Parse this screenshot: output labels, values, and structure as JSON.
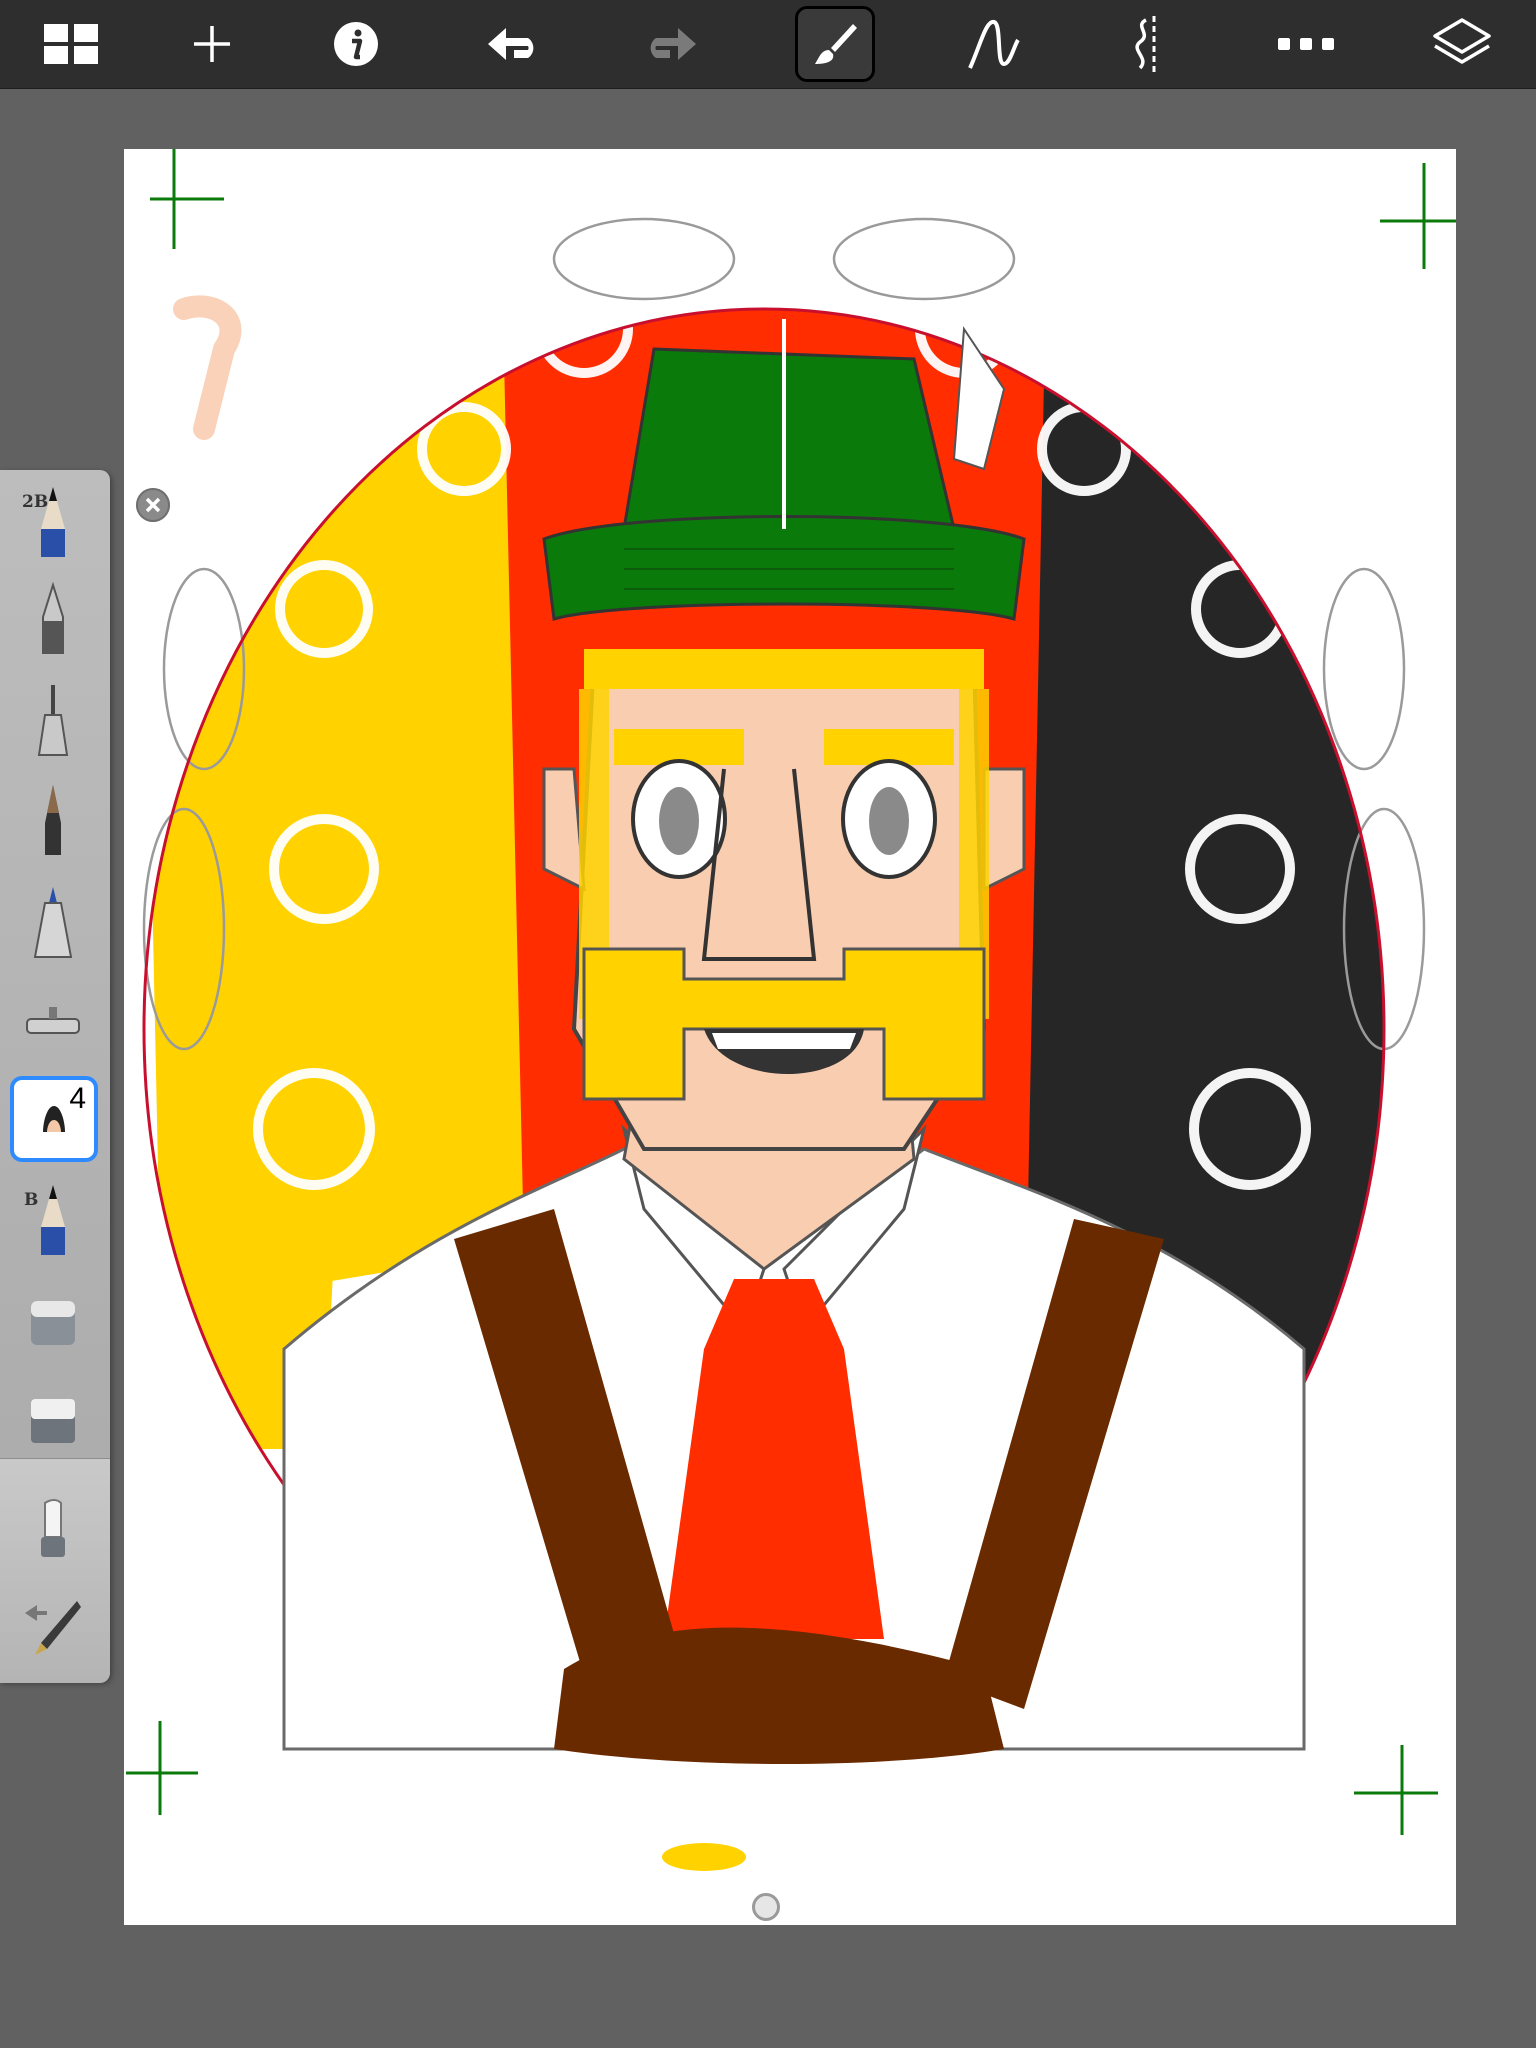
{
  "app": {
    "toolbar": {
      "buttons": [
        {
          "id": "gallery",
          "icon": "grid-icon"
        },
        {
          "id": "new",
          "icon": "plus-icon"
        },
        {
          "id": "info",
          "icon": "info-icon"
        },
        {
          "id": "undo",
          "icon": "undo-icon"
        },
        {
          "id": "redo",
          "icon": "redo-icon",
          "disabled": true
        },
        {
          "id": "brush",
          "icon": "brush-icon",
          "active": true
        },
        {
          "id": "stroke",
          "icon": "stroke-icon"
        },
        {
          "id": "symmetry",
          "icon": "symmetry-icon"
        },
        {
          "id": "more",
          "icon": "more-icon"
        },
        {
          "id": "layers",
          "icon": "layers-icon"
        }
      ]
    },
    "brush_palette": {
      "tools": [
        {
          "icon": "pencil-icon",
          "tag": "2B"
        },
        {
          "icon": "ballpoint-pen-icon"
        },
        {
          "icon": "technical-pen-icon"
        },
        {
          "icon": "paint-brush-icon"
        },
        {
          "icon": "marker-icon"
        },
        {
          "icon": "airbrush-icon"
        },
        {
          "icon": "soft-brush-icon",
          "number": "4",
          "selected": true
        },
        {
          "icon": "blue-pencil-icon",
          "tag": "B"
        },
        {
          "icon": "eraser-icon"
        },
        {
          "icon": "hard-eraser-icon"
        },
        {
          "icon": "smudge-icon"
        },
        {
          "icon": "ink-pen-icon"
        }
      ]
    },
    "canvas": {
      "subject": "alpine-man-portrait",
      "colors": {
        "red": "#ff2d00",
        "yellow": "#ffd200",
        "black": "#262626",
        "green": "#0a7a0a",
        "skin": "#f9cdb0",
        "brown": "#6a2a00",
        "white": "#ffffff"
      }
    }
  }
}
